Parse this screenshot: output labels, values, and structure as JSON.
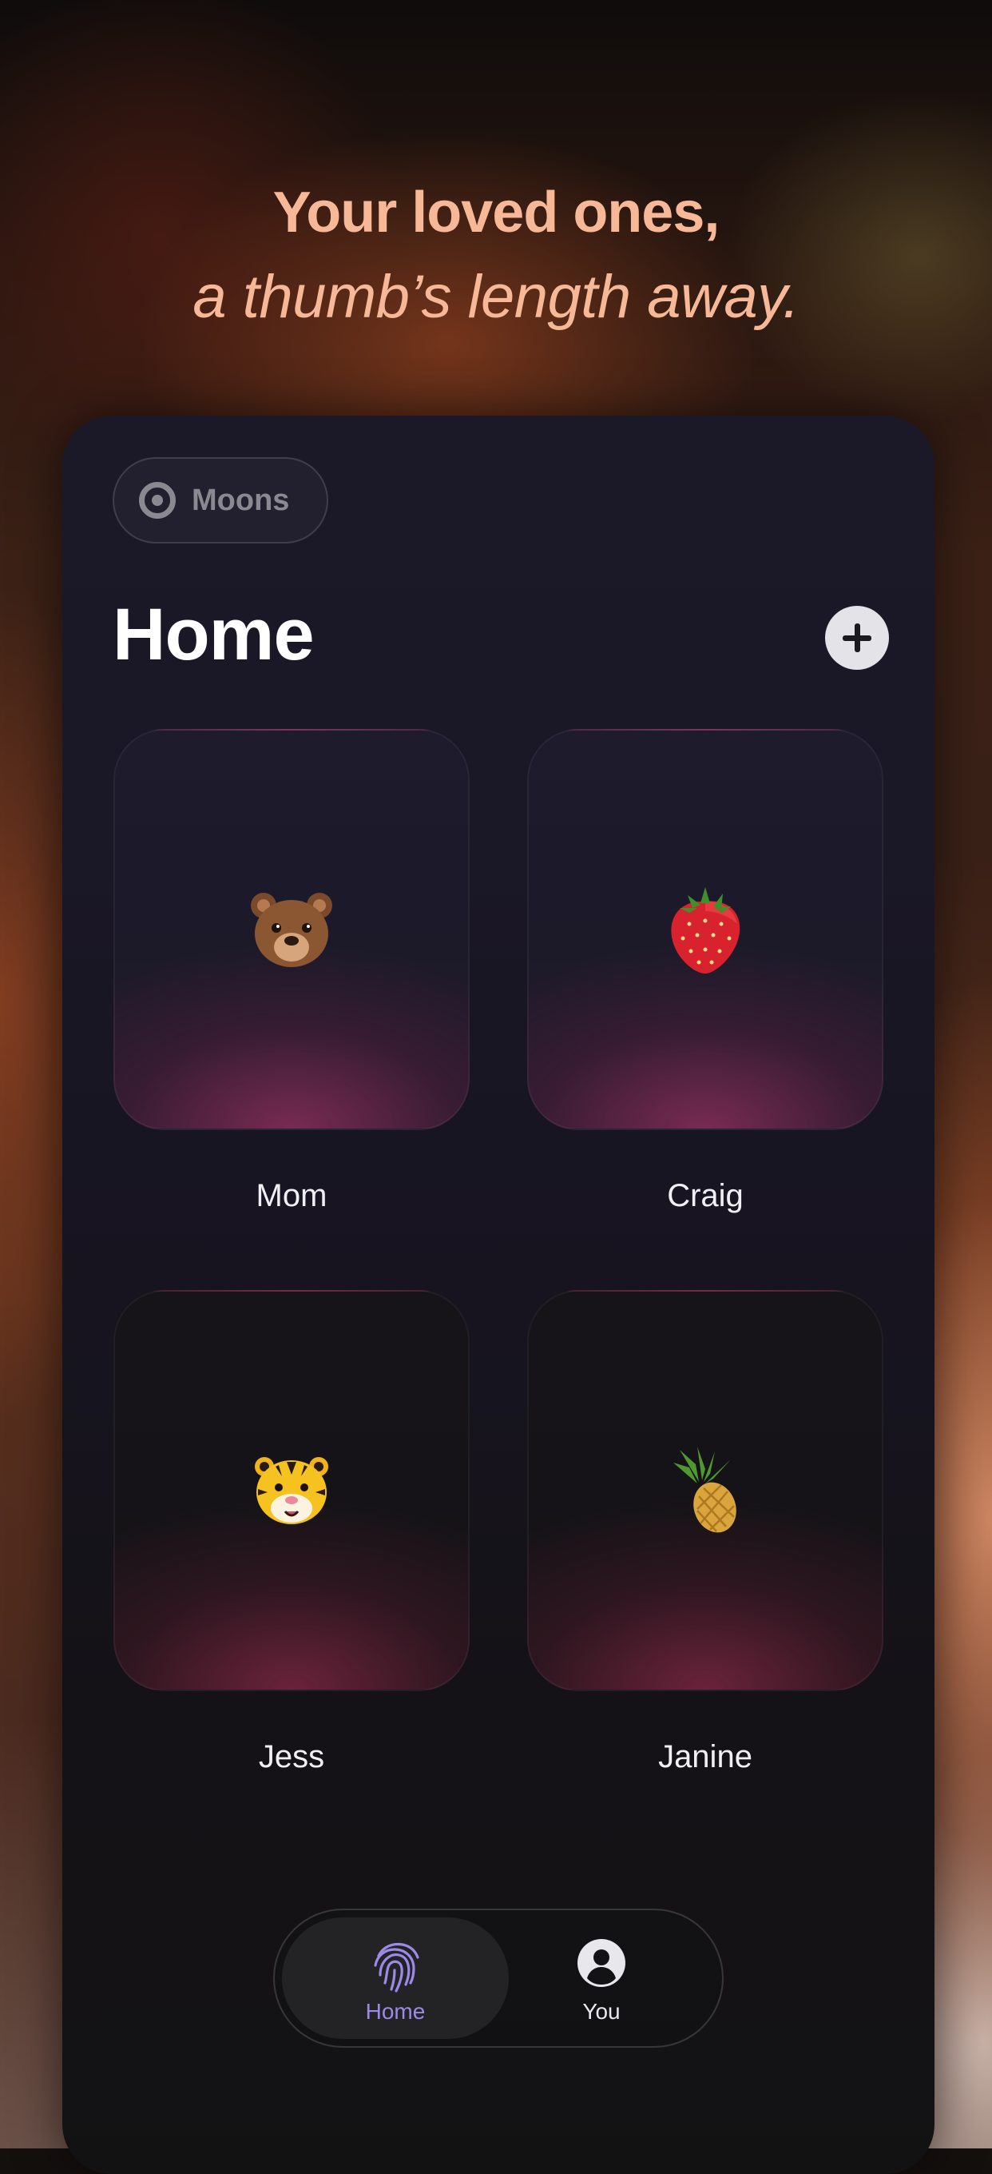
{
  "headline": {
    "line1": "Your loved ones,",
    "line2": "a thumb’s length away."
  },
  "app": {
    "moons_chip": {
      "icon": "moons-icon",
      "label": "Moons"
    },
    "title": "Home",
    "add_button": {
      "icon": "plus-icon"
    },
    "contacts": [
      {
        "name": "Mom",
        "emoji": "🐻",
        "icon": "bear-icon"
      },
      {
        "name": "Craig",
        "emoji": "🍓",
        "icon": "strawberry-icon"
      },
      {
        "name": "Jess",
        "emoji": "🐯",
        "icon": "tiger-icon"
      },
      {
        "name": "Janine",
        "emoji": "🍍",
        "icon": "pineapple-icon"
      }
    ],
    "tabbar": {
      "tabs": [
        {
          "label": "Home",
          "icon": "fingerprint-icon",
          "active": true
        },
        {
          "label": "You",
          "icon": "person-icon",
          "active": false
        }
      ]
    }
  },
  "colors": {
    "headline": "#f6b897",
    "active_tab": "#9d8ae6",
    "card_glow": "#7c2c54"
  }
}
